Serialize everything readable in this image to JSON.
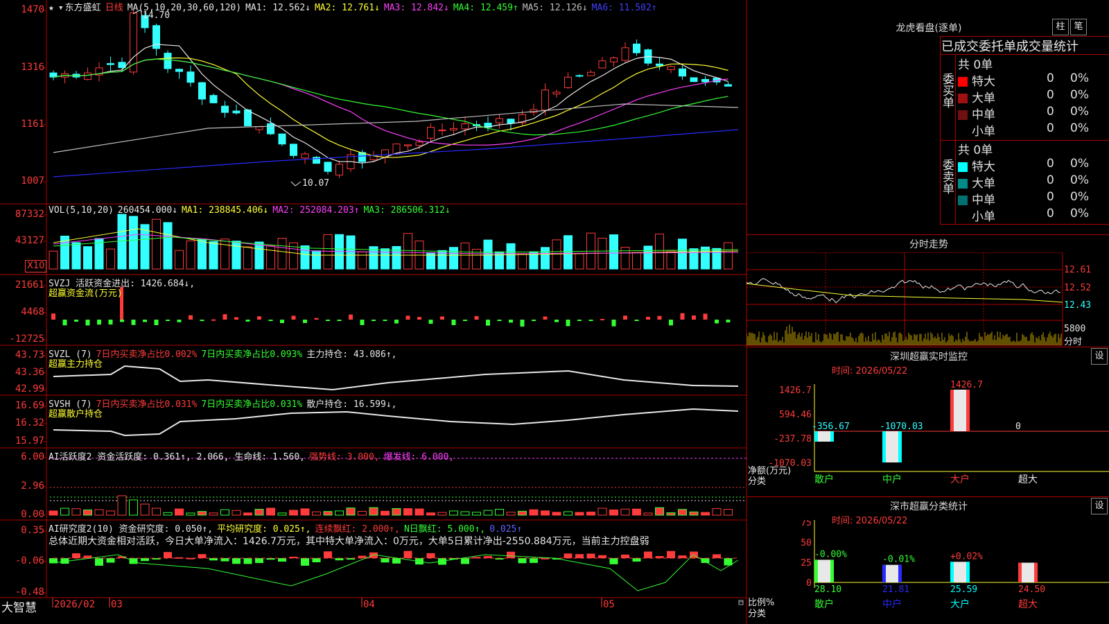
{
  "main": {
    "stock_name": "东方盛虹",
    "period": "日线",
    "ma_header": "MA(5,10,20,30,60,120)",
    "ma": [
      {
        "label": "MA1:",
        "value": "12.562↓",
        "color": "#e8e8e8"
      },
      {
        "label": "MA2:",
        "value": "12.761↓",
        "color": "#ffff33"
      },
      {
        "label": "MA3:",
        "value": "12.842↓",
        "color": "#ff40ff"
      },
      {
        "label": "MA4:",
        "value": "12.459↑",
        "color": "#33ff33"
      },
      {
        "label": "MA5:",
        "value": "12.126↓",
        "color": "#c0c0c0"
      },
      {
        "label": "MA6:",
        "value": "11.502↑",
        "color": "#4040ff"
      }
    ],
    "y_labels": [
      "1470",
      "1316",
      "1161",
      "1007"
    ],
    "high_note": "14.70",
    "low_note": "10.07"
  },
  "vol": {
    "header": "VOL(5,10,20)",
    "value": "260454.000↓",
    "ma1": "MA1: 238845.406↓",
    "ma2": "MA2: 252084.203↑",
    "ma3": "MA3: 286506.312↓",
    "y_labels": [
      "87332",
      "43127"
    ],
    "unit": "X10"
  },
  "svzj": {
    "header": "SVZJ  活跃资金进出: 1426.684↓,",
    "sub": "超赢资金流(万元)",
    "y_labels": [
      "21661",
      "4468",
      "-12725"
    ]
  },
  "svzl": {
    "header": "SVZL (7)",
    "t1": "7日内买卖净占比0.002%",
    "t2": "7日内买卖净占比0.093%",
    "t3": "主力持仓: 43.086↑,",
    "sub": "超赢主力持仓",
    "y_labels": [
      "43.73",
      "43.36",
      "42.99"
    ]
  },
  "svsh": {
    "header": "SVSH (7)",
    "t1": "7日内买卖净占比0.031%",
    "t2": "7日内买卖净占比0.031%",
    "t3": "散户持仓: 16.599↓,",
    "sub": "超赢散户持仓",
    "y_labels": [
      "16.69",
      "16.32",
      "15.97"
    ]
  },
  "ai1": {
    "header": "AI活跃度2 资金活跃度: 0.361↑, 2.066, 生命线: 1.560,",
    "strong": "强势线: 3.000,",
    "burst": "爆发线: 6.000,",
    "y_labels": [
      "6.00",
      "2.96",
      "0.00"
    ]
  },
  "ai2": {
    "header": "AI研究度2(10) 资金研究度: 0.050↑,",
    "avg": "平均研究度: 0.025↑,",
    "cont": "连续飘红: 2.000↑,",
    "nday": "N日飘红: 5.000↑,",
    "last": "0.025↑",
    "summary": "总体近期大资金相对活跃，今日大单净流入：1426.7万元，其中特大单净流入：0万元，大单5日累计净出-2550.884万元，当前主力控盘弱",
    "y_labels": [
      "0.35",
      "-0.06",
      "-0.48"
    ]
  },
  "bottom": {
    "brand": "大智慧",
    "dates": [
      "2026/02",
      "03",
      "04",
      "05"
    ]
  },
  "right": {
    "lhb_title": "龙虎看盘(逐单)",
    "btn1": "柱",
    "btn2": "笔",
    "tabs_title": "已成交委托单成交量统计",
    "buy_label": "委买单",
    "sell_label": "委卖单",
    "buy_total": "共 0单",
    "sell_total": "共 0单",
    "buy_rows": [
      {
        "name": "特大",
        "count": "0",
        "pct": "0%",
        "color": "#ff0000"
      },
      {
        "name": "大单",
        "count": "0",
        "pct": "0%",
        "color": "#a01010"
      },
      {
        "name": "中单",
        "count": "0",
        "pct": "0%",
        "color": "#701010"
      },
      {
        "name": "小单",
        "count": "0",
        "pct": "0%",
        "color": ""
      }
    ],
    "sell_rows": [
      {
        "name": "特大",
        "count": "0",
        "pct": "0%",
        "color": "#00ffff"
      },
      {
        "name": "大单",
        "count": "0",
        "pct": "0%",
        "color": "#008b8b"
      },
      {
        "name": "中单",
        "count": "0",
        "pct": "0%",
        "color": "#007070"
      },
      {
        "name": "小单",
        "count": "0",
        "pct": "0%",
        "color": ""
      }
    ],
    "fenshi_title": "分时走势",
    "fenshi_prices": [
      "12.61",
      "12.52",
      "12.43"
    ],
    "fenshi_vol": "5800",
    "fenshi_unit": "分时",
    "sz_title": "深圳超赢实时监控",
    "sz_time": "时间: 2026/05/22",
    "sz_settings": "设",
    "sz_y": [
      "1426.7",
      "594.46",
      "-237.78",
      "-1070.03"
    ],
    "sz_axis_label1": "净额(万元)",
    "sz_axis_label2": "分类",
    "sz_bars": [
      {
        "name": "散户",
        "value": -356.67,
        "label": "-356.67",
        "color": "#00ffff"
      },
      {
        "name": "中户",
        "value": -1070.03,
        "label": "-1070.03",
        "color": "#00ffff"
      },
      {
        "name": "大户",
        "value": 1426.7,
        "label": "1426.7",
        "color": "#ff3b3b"
      },
      {
        "name": "超大",
        "value": 0,
        "label": "0",
        "color": "#e8e8e8"
      }
    ],
    "cls_title": "深市超赢分类统计",
    "cls_time": "时间: 2026/05/22",
    "cls_settings": "设",
    "cls_y": [
      "75",
      "50",
      "25",
      "0"
    ],
    "cls_axis_label1": "比例%",
    "cls_axis_label2": "分类",
    "cls_bars": [
      {
        "name": "散户",
        "value": 28.1,
        "change": "-0.00%",
        "label": "28.10",
        "color": "#33ff33",
        "change_color": "#33ff33"
      },
      {
        "name": "中户",
        "value": 21.81,
        "change": "-0.01%",
        "label": "21.81",
        "color": "#2a2aff",
        "change_color": "#33ff33"
      },
      {
        "name": "大户",
        "value": 25.59,
        "change": "+0.02%",
        "label": "25.59",
        "color": "#00ffff",
        "change_color": "#ff3b3b"
      },
      {
        "name": "超大",
        "value": 24.5,
        "change": "",
        "label": "24.50",
        "color": "#ff3b3b",
        "change_color": "#ff3b3b"
      }
    ]
  }
}
